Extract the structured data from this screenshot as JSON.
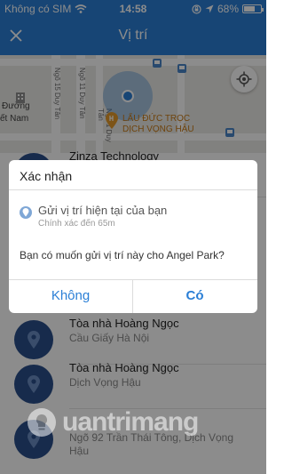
{
  "status_bar": {
    "carrier": "Không có SIM",
    "time": "14:58",
    "battery": "68%",
    "battery_level": 0.68
  },
  "nav": {
    "title": "Vị trí"
  },
  "map": {
    "street_1": "Ngõ 15 Duy Tân",
    "street_2": "Ngõ 11 Duy Tân",
    "street_3": "Ngõ 1 Duy Tân",
    "text_1": "Đường",
    "text_2": "ết Nam",
    "poi_line_1": "LẨU ĐỨC TRỌC",
    "poi_line_2": "DỊCH VỌNG HẬU"
  },
  "list": {
    "items": [
      {
        "name": "Zinza Technology",
        "address": ""
      },
      {
        "name": "Tòa nhà Hoàng Ngọc",
        "address": "Cầu Giấy Hà Nội"
      },
      {
        "name": "Tòa nhà Hoàng Ngọc",
        "address": "Dịch Vọng Hậu"
      },
      {
        "name": "",
        "address": "Ngõ 92 Trần Thái Tông, Dịch Vọng Hậu"
      }
    ]
  },
  "dialog": {
    "title": "Xác nhận",
    "option_title": "Gửi vị trí hiện tại của bạn",
    "option_subtitle": "Chính xác đến 65m",
    "message": "Bạn có muốn gửi vị trí này cho Angel Park?",
    "no_label": "Không",
    "yes_label": "Có"
  },
  "watermark": {
    "text": "uantrimang"
  },
  "colors": {
    "primary": "#2b7fd6",
    "pin": "#2b4f8a",
    "poi": "#c87a16"
  }
}
